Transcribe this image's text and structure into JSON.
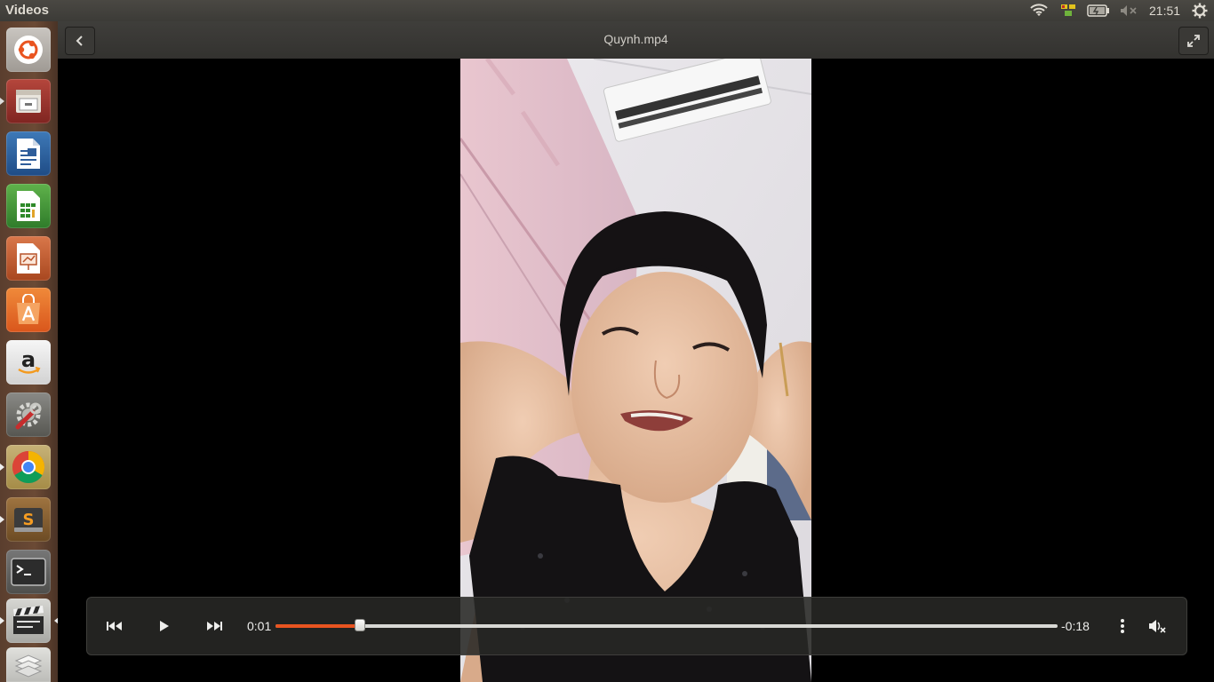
{
  "top_panel": {
    "app_title": "Videos",
    "clock": "21:51",
    "tray_icons": [
      "wifi-icon",
      "transfer-icon",
      "battery-icon",
      "volume-muted-icon",
      "session-gear-icon"
    ]
  },
  "launcher": {
    "items": [
      {
        "name": "ubuntu-dash",
        "icon": "ubuntu-logo-icon"
      },
      {
        "name": "files",
        "icon": "file-cabinet-icon"
      },
      {
        "name": "libreoffice-writer",
        "icon": "writer-document-icon"
      },
      {
        "name": "libreoffice-calc",
        "icon": "calc-spreadsheet-icon"
      },
      {
        "name": "libreoffice-impress",
        "icon": "impress-presentation-icon"
      },
      {
        "name": "ubuntu-software",
        "icon": "software-bag-icon"
      },
      {
        "name": "amazon",
        "icon": "amazon-logo-icon"
      },
      {
        "name": "system-settings",
        "icon": "settings-wrench-icon"
      },
      {
        "name": "google-chrome",
        "icon": "chrome-logo-icon"
      },
      {
        "name": "sublime-text",
        "icon": "sublime-logo-icon"
      },
      {
        "name": "terminal",
        "icon": "terminal-icon"
      },
      {
        "name": "videos",
        "icon": "clapperboard-icon"
      },
      {
        "name": "workspaces",
        "icon": "workspace-stack-icon"
      }
    ]
  },
  "header": {
    "title": "Quynh.mp4",
    "back_icon": "chevron-left-icon",
    "fullscreen_icon": "fullscreen-expand-icon"
  },
  "player": {
    "elapsed": "0:01",
    "remaining": "-0:18",
    "progress_fraction": 0.108,
    "accent_color": "#e95420",
    "buttons": [
      "previous-icon",
      "play-icon",
      "next-icon",
      "menu-dots-icon",
      "volume-muted-icon"
    ]
  }
}
